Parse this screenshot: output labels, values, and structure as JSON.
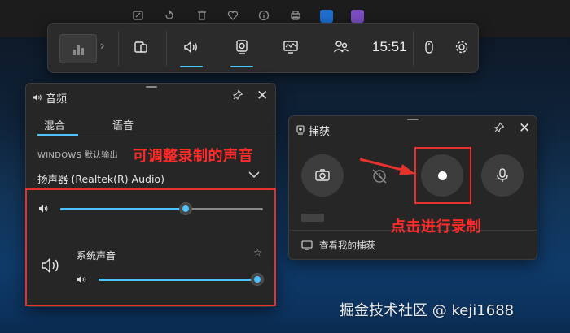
{
  "gamebar": {
    "time": "15:51"
  },
  "audio_panel": {
    "title": "音频",
    "tabs": [
      {
        "label": "混合"
      },
      {
        "label": "语音"
      }
    ],
    "section_label": "WINDOWS 默认输出",
    "device_name": "扬声器 (Realtek(R) Audio)",
    "master_volume": 0.62,
    "app_name": "系统声音",
    "app_volume": 1.0
  },
  "capture_panel": {
    "title": "捕获",
    "gallery_link": "查看我的捕获"
  },
  "annotations": {
    "volume_note": "可调整录制的声音",
    "record_note": "点击进行录制"
  },
  "watermark": "掘金技术社区 @ keji1688",
  "colors": {
    "accent": "#4cc2ff",
    "annotation_red": "#e5322d",
    "panel_bg": "#262626"
  },
  "icons": {
    "top_strip": [
      "edit-image-icon",
      "rotate-icon",
      "delete-icon",
      "favorite-icon",
      "info-icon",
      "print-icon",
      "edge-browser-icon",
      "app-icon"
    ],
    "gamebar": [
      "widget-menu-icon",
      "chevron-right-icon",
      "capture-widget-icon",
      "audio-icon",
      "capture-icon",
      "performance-icon",
      "social-icon",
      "mouse-icon",
      "settings-icon"
    ]
  }
}
